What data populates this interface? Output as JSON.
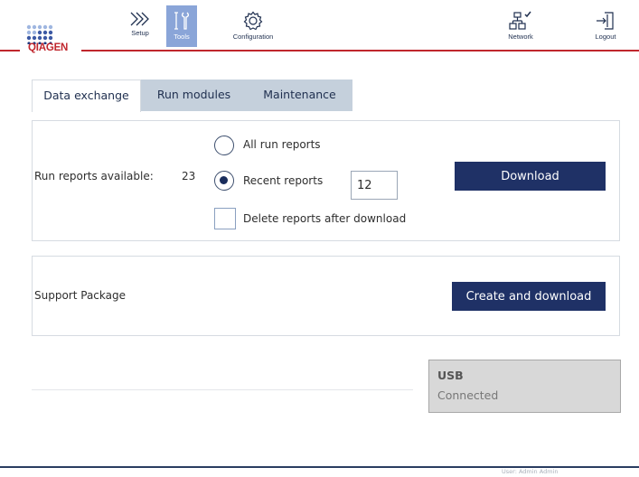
{
  "header": {
    "logo_text": "QIAGEN",
    "brand_color": "#c0262d",
    "nav": [
      {
        "label": "Setup",
        "icon": "chevrons-right-icon"
      },
      {
        "label": "Tools",
        "icon": "tools-icon",
        "active": true
      },
      {
        "label": "Configuration",
        "icon": "gear-icon"
      },
      {
        "label": "Network",
        "icon": "network-icon"
      },
      {
        "label": "Logout",
        "icon": "logout-icon"
      }
    ],
    "active_color": "#8aa5d8"
  },
  "tabs": [
    {
      "label": "Data exchange",
      "active": true
    },
    {
      "label": "Run modules",
      "active": false
    },
    {
      "label": "Maintenance",
      "active": false
    }
  ],
  "run_reports": {
    "label": "Run reports available:",
    "count": "23",
    "options": [
      {
        "label": "All run reports",
        "checked": false
      },
      {
        "label": "Recent reports",
        "checked": true
      }
    ],
    "recent_count": "12",
    "delete_label": "Delete reports after download",
    "delete_checked": false,
    "download_button": "Download"
  },
  "support": {
    "label": "Support Package",
    "button": "Create and download"
  },
  "usb": {
    "title": "USB",
    "status": "Connected"
  },
  "footer": {
    "user": "User: Admin Admin"
  },
  "colors": {
    "primary_button": "#1f3166",
    "tab_inactive": "#c5d0dc",
    "footer_line": "#2a3d61"
  }
}
